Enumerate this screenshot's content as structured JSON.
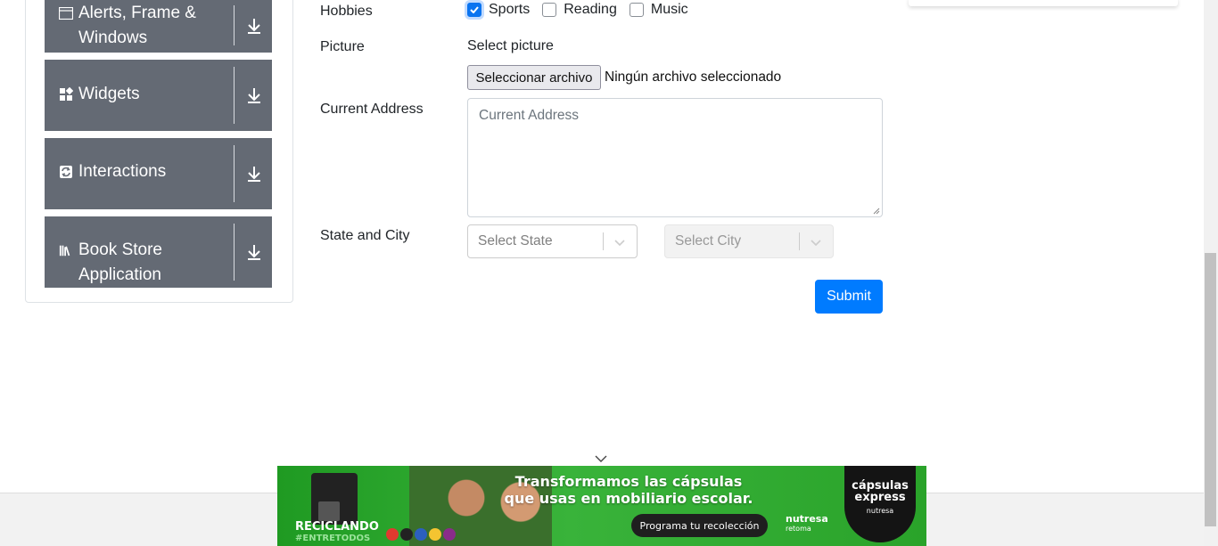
{
  "sidebar": {
    "groups": [
      {
        "label_line1": "Alerts, Frame &",
        "label_line2": "Windows",
        "icon": "window-icon"
      },
      {
        "label": "Widgets",
        "icon": "widgets-icon"
      },
      {
        "label": "Interactions",
        "icon": "interactions-icon"
      },
      {
        "label_line1": "Book Store",
        "label_line2": "Application",
        "icon": "books-icon"
      }
    ]
  },
  "form": {
    "hobbies": {
      "label": "Hobbies",
      "options": [
        {
          "label": "Sports",
          "checked": true
        },
        {
          "label": "Reading",
          "checked": false
        },
        {
          "label": "Music",
          "checked": false
        }
      ]
    },
    "picture": {
      "label": "Picture",
      "prompt": "Select picture",
      "button": "Seleccionar archivo",
      "status": "Ningún archivo seleccionado"
    },
    "address": {
      "label": "Current Address",
      "placeholder": "Current Address"
    },
    "state_city": {
      "label": "State and City",
      "state_placeholder": "Select State",
      "city_placeholder": "Select City"
    },
    "submit": "Submit"
  },
  "ad": {
    "headline1": "Transformamos las cápsulas",
    "headline2": "que usas en mobiliario escolar.",
    "cta": "Programa tu recolección",
    "campaign": "RECICLANDO",
    "hashtag": "#ENTRETODOS",
    "brand_line1": "nutresa",
    "brand_line2": "retoma",
    "badge_line1": "cápsulas express",
    "badge_line2": "nutresa"
  },
  "colors": {
    "sidebar_group": "#646a74",
    "submit": "#007bff",
    "checkbox_checked": "#0a74f0",
    "ad_green": "#2aa52a"
  }
}
